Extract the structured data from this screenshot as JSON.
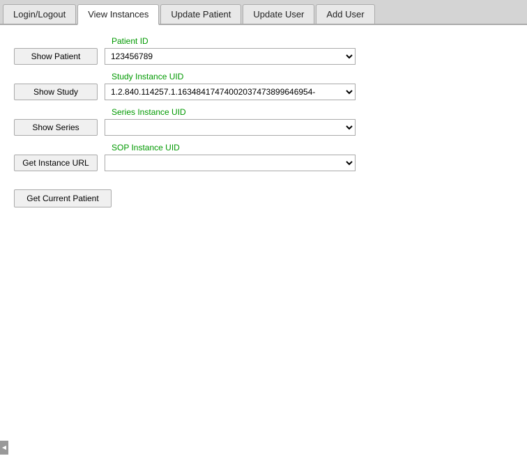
{
  "tabs": [
    {
      "id": "login-logout",
      "label": "Login/Logout",
      "active": false
    },
    {
      "id": "view-instances",
      "label": "View Instances",
      "active": true
    },
    {
      "id": "update-patient",
      "label": "Update Patient",
      "active": false
    },
    {
      "id": "update-user",
      "label": "Update User",
      "active": false
    },
    {
      "id": "add-user",
      "label": "Add User",
      "active": false
    }
  ],
  "form": {
    "patient_id_label": "Patient ID",
    "patient_id_value": "123456789",
    "show_patient_btn": "Show Patient",
    "study_instance_uid_label": "Study Instance UID",
    "study_instance_uid_value": "1.2.840.114257.1.16348417474002037473899646954-",
    "show_study_btn": "Show Study",
    "series_instance_uid_label": "Series Instance UID",
    "series_instance_uid_value": "",
    "show_series_btn": "Show Series",
    "sop_instance_uid_label": "SOP Instance UID",
    "sop_instance_uid_value": "",
    "get_instance_url_btn": "Get Instance URL",
    "get_current_patient_btn": "Get Current Patient"
  },
  "bottom_indicator": "◄"
}
